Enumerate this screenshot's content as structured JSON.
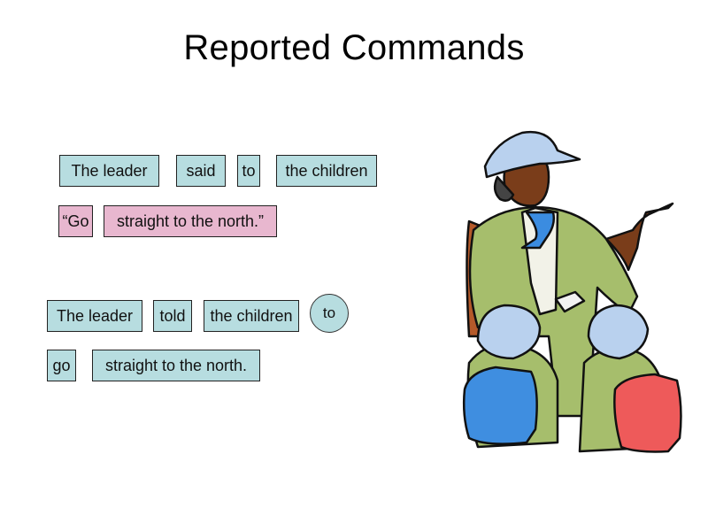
{
  "slide": {
    "title": "Reported Commands",
    "direct_speech": {
      "row1": [
        "The leader",
        "said",
        "to",
        "the children"
      ],
      "row2": [
        "“Go",
        "straight to the north.”"
      ]
    },
    "reported_speech": {
      "row1": [
        "The leader",
        "told",
        "the children"
      ],
      "circled_word": "to",
      "row2": [
        "go",
        "straight to the north."
      ]
    },
    "colors": {
      "blue_box": "#b7dde0",
      "pink_box": "#e8b7cf"
    },
    "illustration": "scout-leader-with-children-clipart"
  }
}
